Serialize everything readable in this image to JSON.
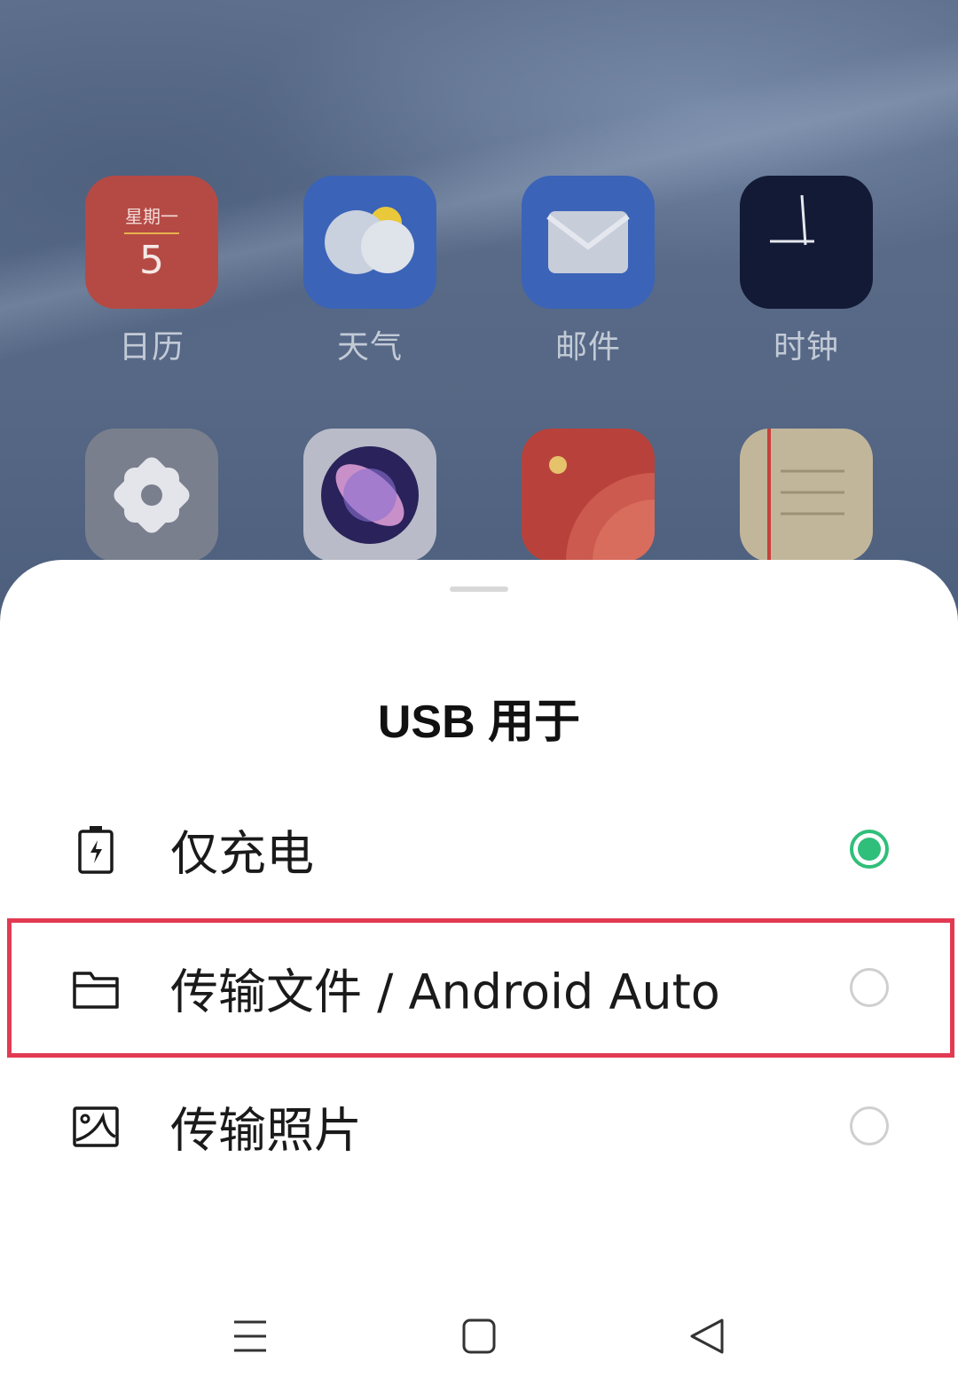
{
  "home_screen": {
    "apps_row1": [
      {
        "label": "日历",
        "weekday": "星期一",
        "day": "5"
      },
      {
        "label": "天气"
      },
      {
        "label": "邮件"
      },
      {
        "label": "时钟"
      }
    ],
    "apps_row2_icons": [
      "settings-icon",
      "planet-browser-icon",
      "photos-icon",
      "notes-icon"
    ]
  },
  "sheet": {
    "title": "USB 用于",
    "options": [
      {
        "label": "仅充电",
        "icon": "battery-charging-icon",
        "selected": true
      },
      {
        "label": "传输文件 / Android Auto",
        "icon": "folder-icon",
        "selected": false,
        "highlighted": true
      },
      {
        "label": "传输照片",
        "icon": "image-icon",
        "selected": false
      }
    ],
    "accent_color": "#2fbf7a",
    "highlight_color": "#e23a53"
  },
  "navbar": {
    "buttons": [
      "menu-icon",
      "home-icon",
      "back-icon"
    ]
  }
}
